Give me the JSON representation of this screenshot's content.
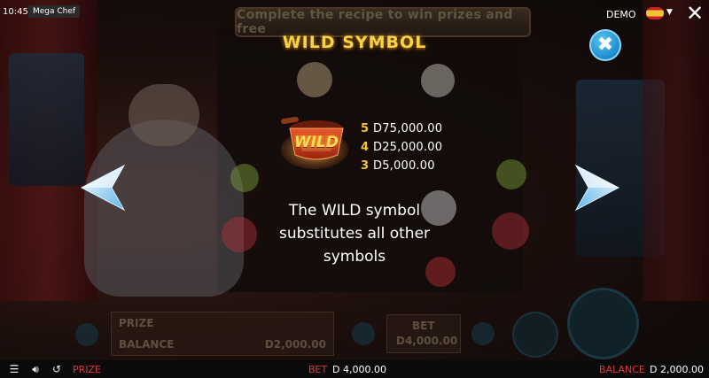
{
  "status": {
    "time": "10:45",
    "game_name": "Mega Chef"
  },
  "top_right": {
    "demo_label": "DEMO",
    "language_flag": "spain-flag-icon",
    "close_icon": "close-x-icon"
  },
  "background": {
    "banner_text": "Complete the recipe to win prizes and free",
    "prize_label": "PRIZE",
    "balance_label": "BALANCE",
    "balance_value": "D2,000.00",
    "bet_label": "BET",
    "bet_value": "D4,000.00"
  },
  "paytable": {
    "title": "WILD SYMBOL",
    "symbol_text": "WILD",
    "pays": [
      {
        "count": "5",
        "amount": "D75,000.00"
      },
      {
        "count": "4",
        "amount": "D25,000.00"
      },
      {
        "count": "3",
        "amount": "D5,000.00"
      }
    ],
    "description_lines": [
      "The WILD symbol",
      "substitutes all other",
      "symbols"
    ],
    "nav": {
      "prev_icon": "chevron-left-icon",
      "next_icon": "chevron-right-icon",
      "close_icon": "close-icon"
    }
  },
  "bottom_bar": {
    "menu_icon": "menu-icon",
    "sound_icon": "speaker-icon",
    "history_icon": "history-icon",
    "prize_label": "PRIZE",
    "bet_label": "BET",
    "bet_value": "D 4,000.00",
    "balance_label": "BALANCE",
    "balance_value": "D 2,000.00"
  },
  "colors": {
    "accent_gold": "#f3d34a",
    "label_red": "#e23a3a",
    "button_blue": "#1e8fd0"
  }
}
